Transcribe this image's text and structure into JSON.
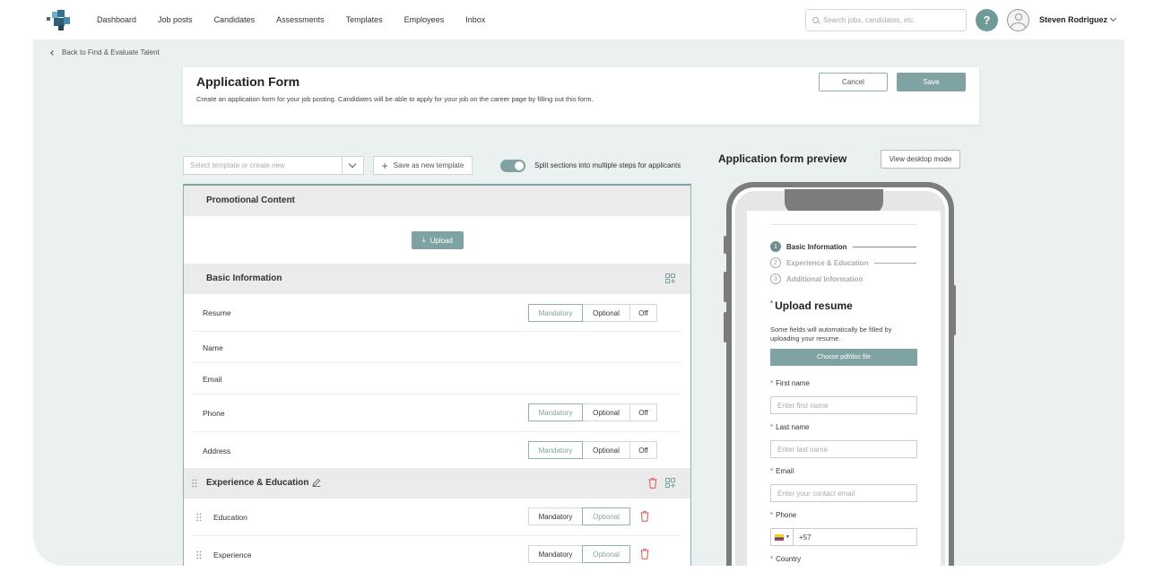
{
  "nav": {
    "links": [
      "Dashboard",
      "Job posts",
      "Candidates",
      "Assessments",
      "Templates",
      "Employees",
      "Inbox"
    ],
    "search_placeholder": "Search jobs, candidates, etc.",
    "help": "?",
    "user_name": "Steven Rodriguez"
  },
  "breadcrumb": {
    "back": "Back to Find & Evaluate Talent"
  },
  "header": {
    "title": "Application Form",
    "description": "Create an application form for your job posting. Candidates will be able to apply for your job on the career page by filling out this form.",
    "cancel": "Cancel",
    "save": "Save"
  },
  "toolbar": {
    "template_placeholder": "Select template or create new",
    "save_template": "Save as new template",
    "split_label": "Split sections into multiple steps for applicants",
    "split_enabled": true
  },
  "builder": {
    "promo": {
      "title": "Promotional Content",
      "upload": "Upload"
    },
    "basic": {
      "title": "Basic Information",
      "rows": [
        {
          "label": "Resume",
          "has_options": true,
          "selected": "Mandatory"
        },
        {
          "label": "Name",
          "has_options": false
        },
        {
          "label": "Email",
          "has_options": false
        },
        {
          "label": "Phone",
          "has_options": true,
          "selected": "Mandatory"
        },
        {
          "label": "Address",
          "has_options": true,
          "selected": "Mandatory"
        }
      ]
    },
    "experience": {
      "title": "Experience & Education",
      "rows": [
        {
          "label": "Education",
          "selected": "Optional"
        },
        {
          "label": "Experience",
          "selected": "Optional"
        }
      ]
    },
    "options": {
      "mandatory": "Mandatory",
      "optional": "Optional",
      "off": "Off"
    }
  },
  "preview": {
    "title": "Application form preview",
    "view_desktop": "View desktop mode",
    "steps": [
      {
        "num": "1",
        "label": "Basic Information"
      },
      {
        "num": "2",
        "label": "Experience & Education"
      },
      {
        "num": "3",
        "label": "Additional Information"
      }
    ],
    "upload_title": "Upload resume",
    "upload_desc": "Some fields will automatically be filled by uploading your resume.",
    "choose_file": "Choose pdf/doc file",
    "fields": [
      {
        "label": "First name",
        "placeholder": "Enter first name"
      },
      {
        "label": "Last name",
        "placeholder": "Enter last name"
      },
      {
        "label": "Email",
        "placeholder": "Enter your contact email"
      },
      {
        "label": "Phone",
        "placeholder": "+57"
      },
      {
        "label": "Country",
        "placeholder": ""
      }
    ]
  },
  "colors": {
    "accent": "#7fa3a2",
    "danger": "#d9534f",
    "background": "#ebf0f0"
  }
}
